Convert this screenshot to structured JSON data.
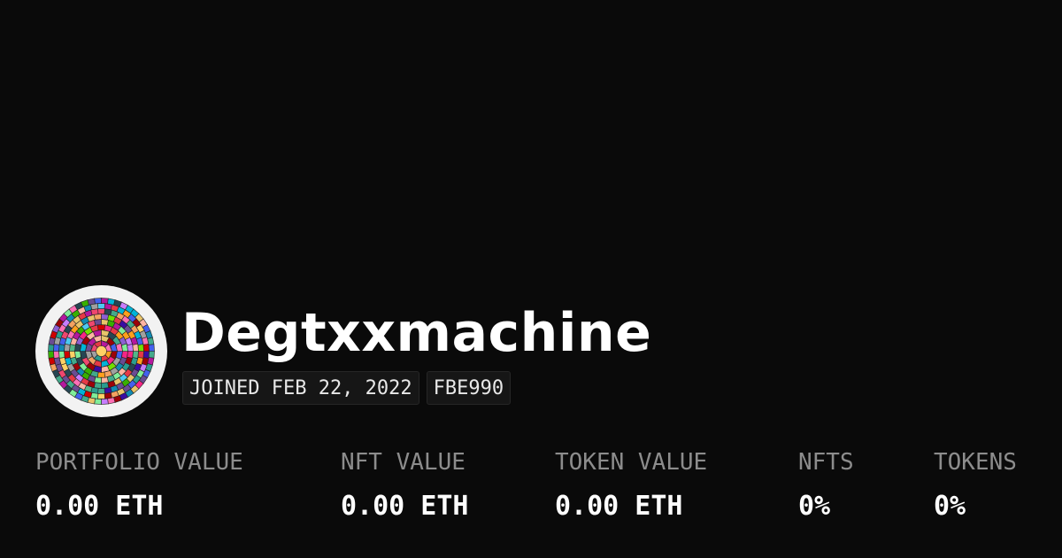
{
  "profile": {
    "username": "Degtxxmachine",
    "avatar_icon": "mosaic-avatar-icon",
    "badges": {
      "joined": "JOINED FEB 22, 2022",
      "color": "FBE990"
    }
  },
  "stats": [
    {
      "label": "PORTFOLIO VALUE",
      "value": "0.00 ETH"
    },
    {
      "label": "NFT VALUE",
      "value": "0.00 ETH"
    },
    {
      "label": "TOKEN VALUE",
      "value": "0.00 ETH"
    },
    {
      "label": "NFTS",
      "value": "0%"
    },
    {
      "label": "TOKENS",
      "value": "0%"
    }
  ],
  "colors": {
    "background": "#0a0a0a",
    "text": "#ffffff",
    "label": "#8c8c8c",
    "badge_bg": "#161616"
  }
}
